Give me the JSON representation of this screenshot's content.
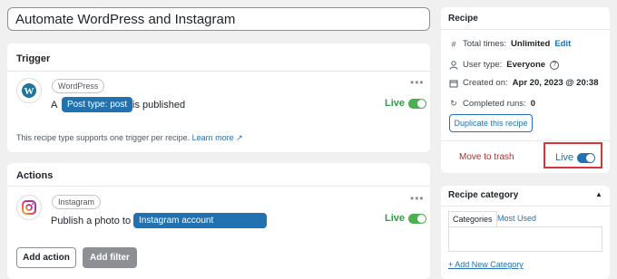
{
  "recipe_title": "Automate WordPress and Instagram",
  "trigger": {
    "heading": "Trigger",
    "integration": "WordPress",
    "sentence_prefix": "A",
    "token": "Post type: post",
    "sentence_suffix": "is published",
    "live_label": "Live",
    "note": "This recipe type supports one trigger per recipe.",
    "learn_more": "Learn more"
  },
  "actions": {
    "heading": "Actions",
    "integration": "Instagram",
    "sentence_prefix": "Publish a photo to",
    "token": "Instagram account",
    "live_label": "Live",
    "add_action": "Add action",
    "add_filter": "Add filter"
  },
  "recipe_panel": {
    "heading": "Recipe",
    "total_times_label": "Total times:",
    "total_times_value": "Unlimited",
    "edit_link": "Edit",
    "user_type_label": "User type:",
    "user_type_value": "Everyone",
    "created_label": "Created on:",
    "created_value": "Apr 20, 2023 @ 20:38",
    "completed_label": "Completed runs:",
    "completed_value": "0",
    "duplicate_button": "Duplicate this recipe",
    "trash_link": "Move to trash",
    "live_label": "Live"
  },
  "category_panel": {
    "heading": "Recipe category",
    "tabs": [
      "Categories",
      "Most Used"
    ],
    "add_new": "+ Add New Category"
  },
  "colors": {
    "accent": "#2271b1",
    "live_green": "#2f9e44",
    "trash_red": "#b32d2e",
    "highlight_box": "#d63638"
  }
}
